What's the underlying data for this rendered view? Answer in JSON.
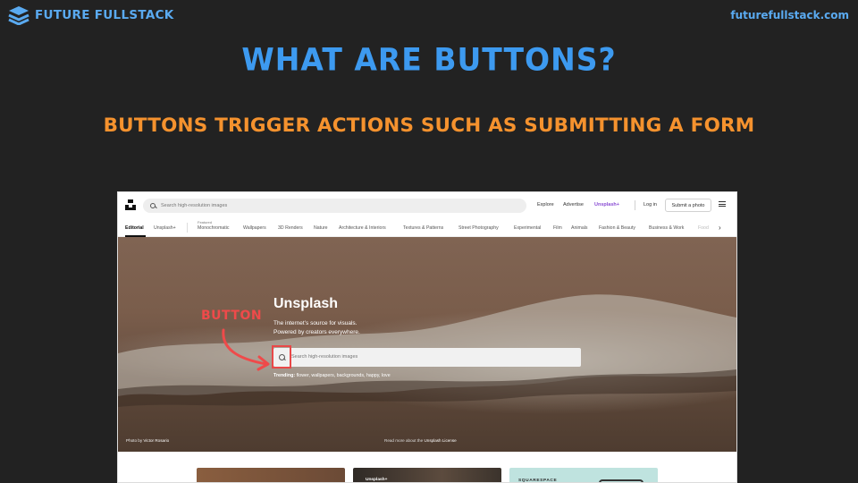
{
  "slide": {
    "brand": "FUTURE FULLSTACK",
    "url": "futurefullstack.com",
    "title": "WHAT ARE BUTTONS?",
    "subtitle": "BUTTONS TRIGGER ACTIONS SUCH AS SUBMITTING A FORM",
    "annotation": "BUTTON",
    "colors": {
      "brand_blue": "#3d9af0",
      "subtitle_orange": "#f5922e",
      "annotation_red": "#ef4a4a",
      "background": "#222222"
    }
  },
  "header": {
    "search_placeholder": "Search high-resolution images",
    "nav": {
      "explore": "Explore",
      "advertise": "Advertise",
      "unsplash_plus": "Unsplash+",
      "login": "Log in",
      "submit": "Submit a photo"
    }
  },
  "topics": {
    "featured_tag": "Featured",
    "items": [
      "Editorial",
      "Unsplash+",
      "Monochromatic",
      "Wallpapers",
      "3D Renders",
      "Nature",
      "Architecture & Interiors",
      "Textures & Patterns",
      "Street Photography",
      "Experimental",
      "Film",
      "Animals",
      "Fashion & Beauty",
      "Business & Work",
      "Food"
    ]
  },
  "hero": {
    "title": "Unsplash",
    "line1": "The internet’s source for visuals.",
    "line2": "Powered by creators everywhere.",
    "search_placeholder": "Search high-resolution images",
    "trending_label": "Trending:",
    "trending_terms": "flower, wallpapers, backgrounds, happy, love",
    "photo_credit_prefix": "Photo by",
    "photo_credit_name": "Victor Rosario",
    "license_prefix": "Read more about the",
    "license_name": "Unsplash License"
  },
  "cards": {
    "card2_label": "Unsplash+",
    "card3_label": "SQUARESPACE"
  }
}
